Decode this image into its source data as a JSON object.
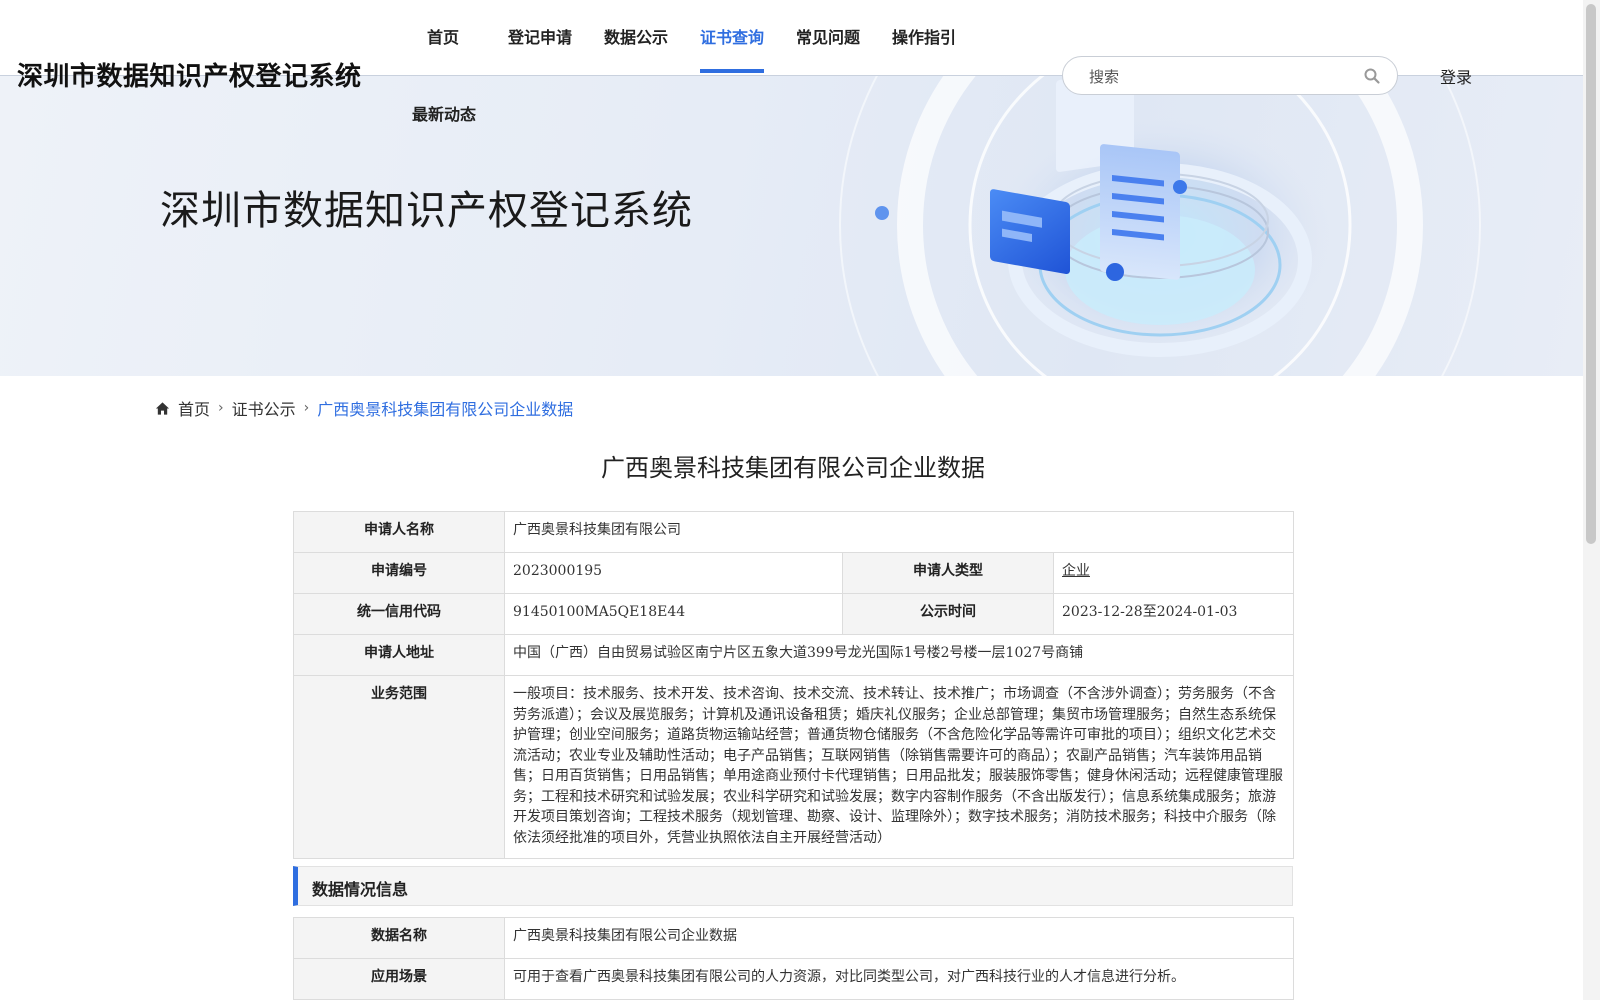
{
  "header": {
    "site_title": "深圳市数据知识产权登记系统",
    "nav": [
      {
        "label": "首页"
      },
      {
        "label": "登记申请"
      },
      {
        "label": "数据公示"
      },
      {
        "label": "证书查询",
        "active": true
      },
      {
        "label": "常见问题"
      },
      {
        "label": "操作指引"
      },
      {
        "label": "最新动态"
      }
    ],
    "search_placeholder": "搜索",
    "login_label": "登录"
  },
  "banner": {
    "title": "深圳市数据知识产权登记系统"
  },
  "breadcrumb": {
    "items": [
      "首页",
      "证书公示",
      "广西奥景科技集团有限公司企业数据"
    ]
  },
  "page_title": "广西奥景科技集团有限公司企业数据",
  "applicant": {
    "name_label": "申请人名称",
    "name_value": "广西奥景科技集团有限公司",
    "number_label": "申请编号",
    "number_value": "2023000195",
    "type_label": "申请人类型",
    "type_value": "企业",
    "credit_label": "统一信用代码",
    "credit_value": "91450100MA5QE18E44",
    "time_label": "公示时间",
    "time_value": "2023-12-28至2024-01-03",
    "address_label": "申请人地址",
    "address_value": "中国（广西）自由贸易试验区南宁片区五象大道399号龙光国际1号楼2号楼一层1027号商铺",
    "scope_label": "业务范围",
    "scope_value": "一般项目：技术服务、技术开发、技术咨询、技术交流、技术转让、技术推广；市场调查（不含涉外调查）；劳务服务（不含劳务派遣）；会议及展览服务；计算机及通讯设备租赁；婚庆礼仪服务；企业总部管理；集贸市场管理服务；自然生态系统保护管理；创业空间服务；道路货物运输站经营；普通货物仓储服务（不含危险化学品等需许可审批的项目）；组织文化艺术交流活动；农业专业及辅助性活动；电子产品销售；互联网销售（除销售需要许可的商品）；农副产品销售；汽车装饰用品销售；日用百货销售；日用品销售；单用途商业预付卡代理销售；日用品批发；服装服饰零售；健身休闲活动；远程健康管理服务；工程和技术研究和试验发展；农业科学研究和试验发展；数字内容制作服务（不含出版发行）；信息系统集成服务；旅游开发项目策划咨询；工程技术服务（规划管理、勘察、设计、监理除外）；数字技术服务；消防技术服务；科技中介服务（除依法须经批准的项目外，凭营业执照依法自主开展经营活动）"
  },
  "data_section": {
    "title": "数据情况信息",
    "data_name_label": "数据名称",
    "data_name_value": "广西奥景科技集团有限公司企业数据",
    "scene_label": "应用场景",
    "scene_value": "可用于查看广西奥景科技集团有限公司的人力资源，对比同类型公司，对广西科技行业的人才信息进行分析。"
  },
  "colors": {
    "accent": "#2f6ee0",
    "label_bg": "#f4f4f4",
    "border": "#dcdcdc"
  }
}
